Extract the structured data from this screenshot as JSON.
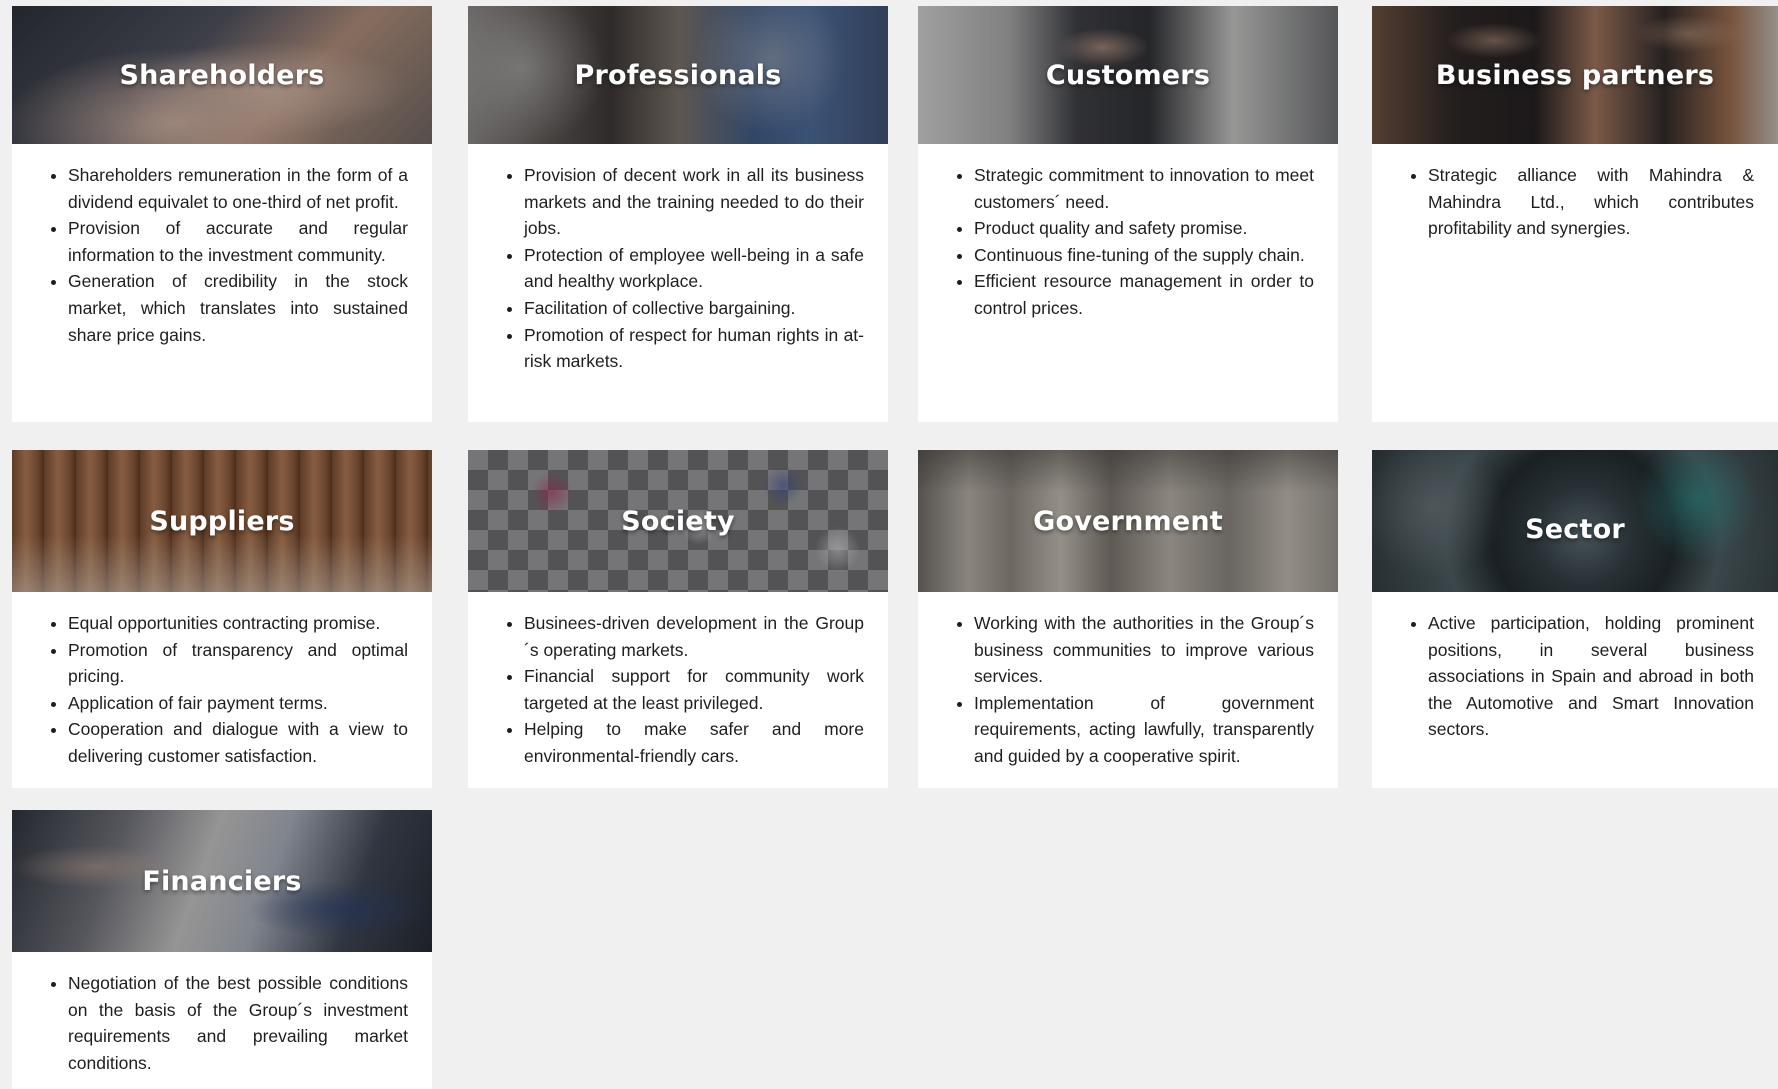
{
  "colors": {
    "page_background": "#f0f0f0",
    "card_background": "#ffffff",
    "title_text": "#ffffff",
    "body_text": "#1e1e1e"
  },
  "cards": [
    {
      "title": "Shareholders",
      "image": "hands-on-desk-photo",
      "items": [
        "Shareholders remuneration in the form of a dividend equivalet to one-third of net profit.",
        "Provision of accurate and regular information to the investment community.",
        "Generation of credibility in the stock market, which translates into sustained share price gains."
      ]
    },
    {
      "title": "Professionals",
      "image": "workers-with-wheels-photo",
      "items": [
        "Provision of decent work in all its business markets and the training needed to do their jobs.",
        "Protection of employee well-being in a safe and healthy workplace.",
        "Facilitation of collective bargaining.",
        "Promotion of respect for human rights in at-risk markets."
      ]
    },
    {
      "title": "Customers",
      "image": "businessman-photo",
      "items": [
        "Strategic commitment to innovation to meet customers´ need.",
        "Product quality and safety promise.",
        "Continuous fine-tuning of the supply chain.",
        "Efficient resource management in order to control prices."
      ]
    },
    {
      "title": "Business partners",
      "image": "business-partners-photo",
      "items": [
        "Strategic alliance with Mahindra & Mahindra Ltd., which contributes profitability and synergies."
      ]
    },
    {
      "title": "Suppliers",
      "image": "paper-rolls-photo",
      "items": [
        "Equal opportunities contracting promise.",
        "Promotion of transparency and optimal pricing.",
        "Application of fair payment terms.",
        "Cooperation and dialogue with a view to delivering customer satisfaction."
      ]
    },
    {
      "title": "Society",
      "image": "crowd-walking-photo",
      "items": [
        "Businees-driven development in the Group´s operating markets.",
        "Financial support for community work targeted at the least privileged.",
        "Helping to make safer and more environmental-friendly cars."
      ]
    },
    {
      "title": "Government",
      "image": "stone-columns-photo",
      "items": [
        "Working with the authorities in the Group´s business communities to improve various services.",
        "Implementation of government requirements, acting lawfully, transparently and guided by a cooperative spirit."
      ]
    },
    {
      "title": "Sector",
      "image": "machinery-photo",
      "items": [
        "Active participation, holding prominent positions, in several business associations in Spain and abroad in both the Automotive and Smart Innovation sectors."
      ]
    },
    {
      "title": "Financiers",
      "image": "man-with-tablet-photo",
      "items": [
        "Negotiation of the best possible conditions on the basis of the Group´s investment requirements and prevailing market conditions."
      ]
    }
  ]
}
